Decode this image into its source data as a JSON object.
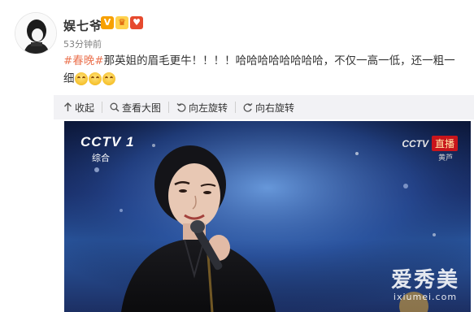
{
  "post": {
    "username": "娱七爷",
    "timestamp": "53分钟前",
    "hashtag": "#春晚#",
    "text": "那英姐的眉毛更牛！！！！哈哈哈哈哈哈哈哈，不仅一高一低，还一粗一细",
    "emojis": [
      "laugh-cry-emoji",
      "laugh-cry-emoji",
      "laugh-cry-emoji"
    ],
    "badges": [
      "verified-badge",
      "crown-badge",
      "heart-badge"
    ]
  },
  "toolbar": {
    "collapse_label": "收起",
    "view_large_label": "查看大图",
    "rotate_left_label": "向左旋转",
    "rotate_right_label": "向右旋转"
  },
  "image": {
    "channel_logo": "CCTV 1",
    "channel_sub": "综合",
    "live_logo": "CCTV",
    "live_label": "直播",
    "live_sub": "黄芦",
    "watermark_cn": "爱秀美",
    "watermark_url": "ixiumei.com"
  },
  "colors": {
    "hashtag": "#eb7350",
    "toolbar_bg": "#f2f2f5",
    "verified": "#f7a000"
  }
}
